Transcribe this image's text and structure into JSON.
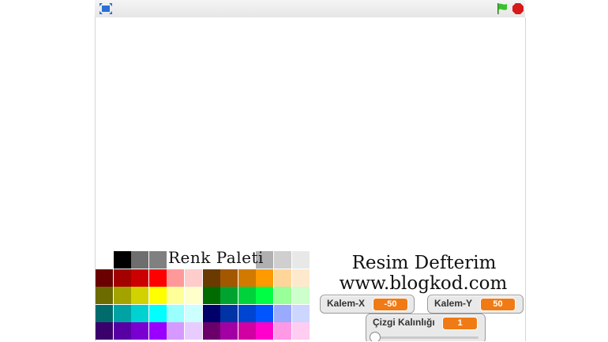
{
  "toolbar": {
    "fullscreen_icon": "fullscreen-icon",
    "green_flag_icon": "green-flag-icon",
    "stop_icon": "stop-icon",
    "flag_color": "#3ac12a",
    "stop_color": "#d61a1a"
  },
  "palette": {
    "title": "Renk Paleti",
    "rows": [
      [
        "",
        "#000000",
        "#6e6e6e",
        "#808080",
        "",
        "",
        "",
        "",
        "",
        "#b0b0b0",
        "#cfcfcf",
        "#e8e8e8"
      ],
      [
        "#6b0000",
        "#a30000",
        "#cc0000",
        "#ff0000",
        "#ff9999",
        "#ffcccc",
        "#6b3a00",
        "#a35800",
        "#d27a00",
        "#ff9a00",
        "#ffd699",
        "#ffe9cc"
      ],
      [
        "#6b6b00",
        "#a3a300",
        "#d2d200",
        "#ffff00",
        "#ffff99",
        "#ffffcc",
        "#006b00",
        "#00a330",
        "#00d23c",
        "#00ff44",
        "#99ff99",
        "#ccffcc"
      ],
      [
        "#006b6b",
        "#00a3a3",
        "#00d2d2",
        "#00ffff",
        "#99ffff",
        "#ccffff",
        "#00006b",
        "#0033a3",
        "#0044d2",
        "#0055ff",
        "#99aaff",
        "#ccd6ff"
      ],
      [
        "#3a006b",
        "#5800a3",
        "#7a00d2",
        "#9900ff",
        "#d699ff",
        "#e9ccff",
        "#6b006b",
        "#a300a3",
        "#d200a3",
        "#ff00cc",
        "#ff99e6",
        "#ffccf2"
      ]
    ]
  },
  "app": {
    "title": "Resim Defterim",
    "url": "www.blogkod.com"
  },
  "monitors": {
    "kalem_x": {
      "label": "Kalem-X",
      "value": "-50"
    },
    "kalem_y": {
      "label": "Kalem-Y",
      "value": "50"
    },
    "cizgi": {
      "label": "Çizgi Kalınlığı",
      "value": "1",
      "slider_fraction": 0
    }
  }
}
